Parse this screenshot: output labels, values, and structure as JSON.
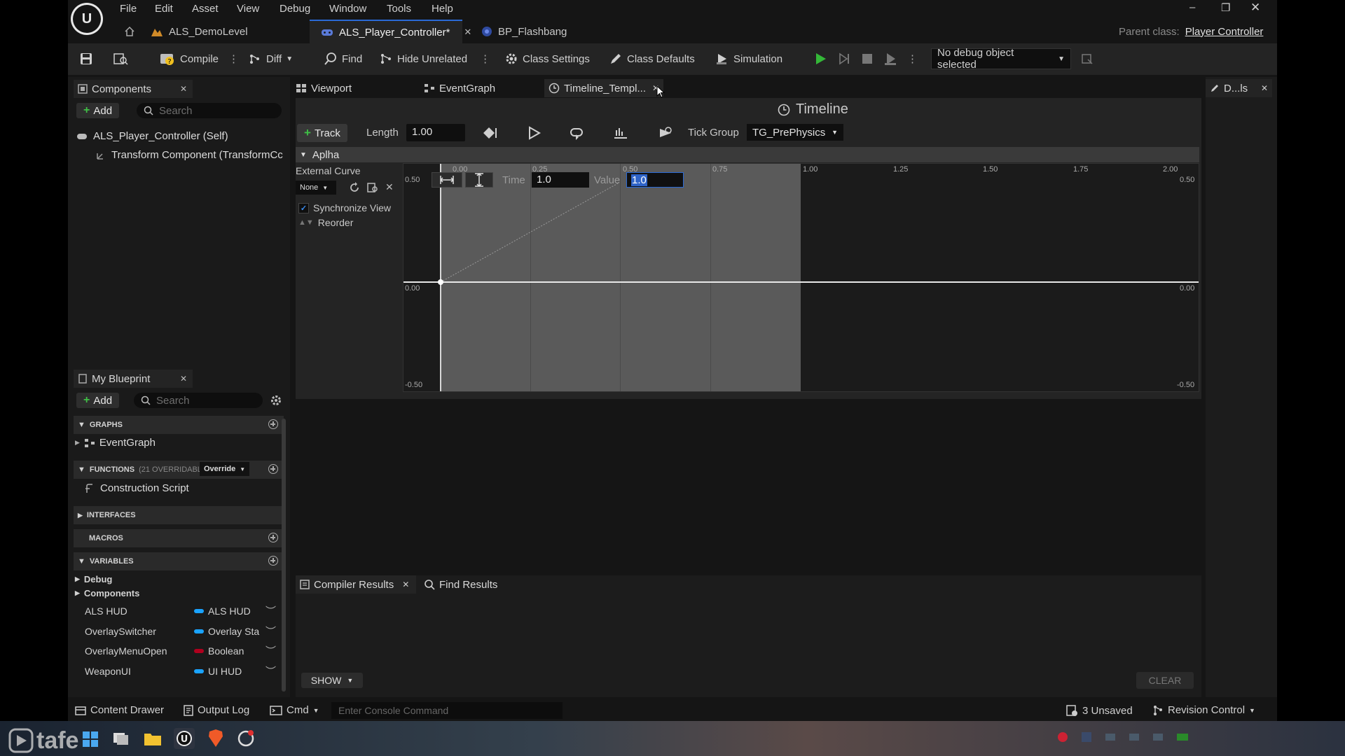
{
  "menu": [
    "File",
    "Edit",
    "Asset",
    "View",
    "Debug",
    "Window",
    "Tools",
    "Help"
  ],
  "window_controls": {
    "minimize": "–",
    "restore": "❐",
    "close": "✕"
  },
  "tabs": {
    "level": "ALS_DemoLevel",
    "active": "ALS_Player_Controller*",
    "other": "BP_Flashbang",
    "parent_class_label": "Parent class:",
    "parent_class_value": "Player Controller"
  },
  "toolbar": {
    "compile": "Compile",
    "diff": "Diff",
    "find": "Find",
    "hide_unrelated": "Hide Unrelated",
    "class_settings": "Class Settings",
    "class_defaults": "Class Defaults",
    "simulation": "Simulation",
    "debug_object": "No debug object selected"
  },
  "components_panel": {
    "title": "Components",
    "add": "Add",
    "search_placeholder": "Search",
    "items": [
      "ALS_Player_Controller (Self)",
      "Transform Component (TransformCc"
    ]
  },
  "my_blueprint": {
    "title": "My Blueprint",
    "add": "Add",
    "search_placeholder": "Search",
    "graphs": "GRAPHS",
    "eventgraph": "EventGraph",
    "functions": "FUNCTIONS",
    "functions_count": "(21 OVERRIDABLI",
    "override": "Override",
    "construction_script": "Construction Script",
    "interfaces": "INTERFACES",
    "macros": "MACROS",
    "variables": "VARIABLES",
    "var_groups": [
      "Debug",
      "Components"
    ],
    "var_list": [
      {
        "name": "ALS HUD",
        "type": "ALS HUD",
        "color": "#1aa3ff"
      },
      {
        "name": "OverlaySwitcher",
        "type": "Overlay Sta",
        "color": "#1aa3ff"
      },
      {
        "name": "OverlayMenuOpen",
        "type": "Boolean",
        "color": "#b0001e"
      },
      {
        "name": "WeaponUI",
        "type": "UI HUD",
        "color": "#1aa3ff"
      }
    ]
  },
  "editor_tabs": {
    "viewport": "Viewport",
    "eventgraph": "EventGraph",
    "timeline": "Timeline_Templ...",
    "details": "D...ls"
  },
  "timeline": {
    "title": "Timeline",
    "track": "Track",
    "length_label": "Length",
    "length_value": "1.00",
    "tick_group_label": "Tick Group",
    "tick_group_value": "TG_PrePhysics",
    "track_name": "Aplha",
    "external_curve": "External Curve",
    "none": "None",
    "sync_view": "Synchronize View",
    "reorder": "Reorder",
    "time_label": "Time",
    "time_value": "1.0",
    "value_label": "Value",
    "value_value": "1.0",
    "x_ticks": [
      "0.00",
      "0.25",
      "0.50",
      "0.75",
      "1.00",
      "1.25",
      "1.50",
      "1.75",
      "2.00"
    ],
    "y_left": [
      "0.50",
      "0.00",
      "-0.50"
    ],
    "y_right": [
      "0.50",
      "0.00",
      "-0.50"
    ]
  },
  "bottom_panel": {
    "compiler_results": "Compiler Results",
    "find_results": "Find Results",
    "show": "SHOW",
    "clear": "CLEAR"
  },
  "statusbar": {
    "content_drawer": "Content Drawer",
    "output_log": "Output Log",
    "cmd": "Cmd",
    "console_placeholder": "Enter Console Command",
    "unsaved": "3 Unsaved",
    "revision_control": "Revision Control"
  },
  "watermark": "tafe"
}
